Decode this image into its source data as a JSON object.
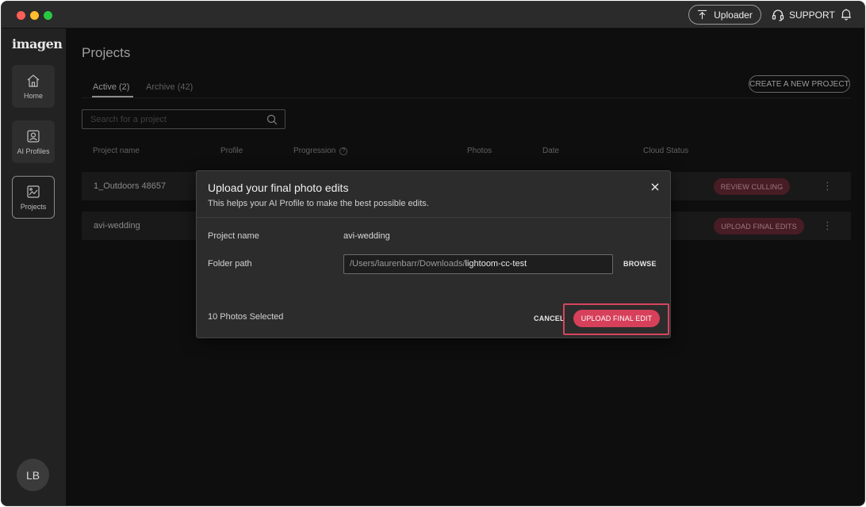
{
  "titlebar": {
    "uploader_label": "Uploader",
    "support_label": "SUPPORT"
  },
  "sidebar": {
    "logo": "imagen",
    "items": [
      {
        "label": "Home",
        "icon": "home-icon"
      },
      {
        "label": "AI Profiles",
        "icon": "ai-profile-icon"
      },
      {
        "label": "Projects",
        "icon": "projects-icon",
        "active": true
      }
    ],
    "avatar_initials": "LB"
  },
  "main": {
    "title": "Projects",
    "tabs": [
      {
        "label": "Active (2)",
        "active": true
      },
      {
        "label": "Archive (42)",
        "active": false
      }
    ],
    "create_button": "CREATE A NEW PROJECT",
    "search_placeholder": "Search for a project",
    "columns": [
      "Project name",
      "Profile",
      "Progression",
      "Photos",
      "Date",
      "Cloud Status"
    ],
    "rows": [
      {
        "name": "1_Outdoors 48657",
        "action": "REVIEW CULLING"
      },
      {
        "name": "avi-wedding",
        "action": "UPLOAD FINAL EDITS"
      }
    ]
  },
  "modal": {
    "title": "Upload your final photo edits",
    "subtitle": "This helps your AI Profile to make the best possible edits.",
    "project_name_label": "Project name",
    "project_name_value": "avi-wedding",
    "folder_path_label": "Folder path",
    "folder_path_prefix": "/Users/laurenbarr/Downloads/",
    "folder_path_folder": "lightoom-cc-test",
    "browse_label": "BROWSE",
    "selected_text": "10 Photos Selected",
    "cancel_label": "CANCEL",
    "upload_label": "UPLOAD FINAL EDIT"
  },
  "colors": {
    "accent": "#d7405a",
    "pill_bg": "#6b2a35",
    "background": "#151515"
  }
}
